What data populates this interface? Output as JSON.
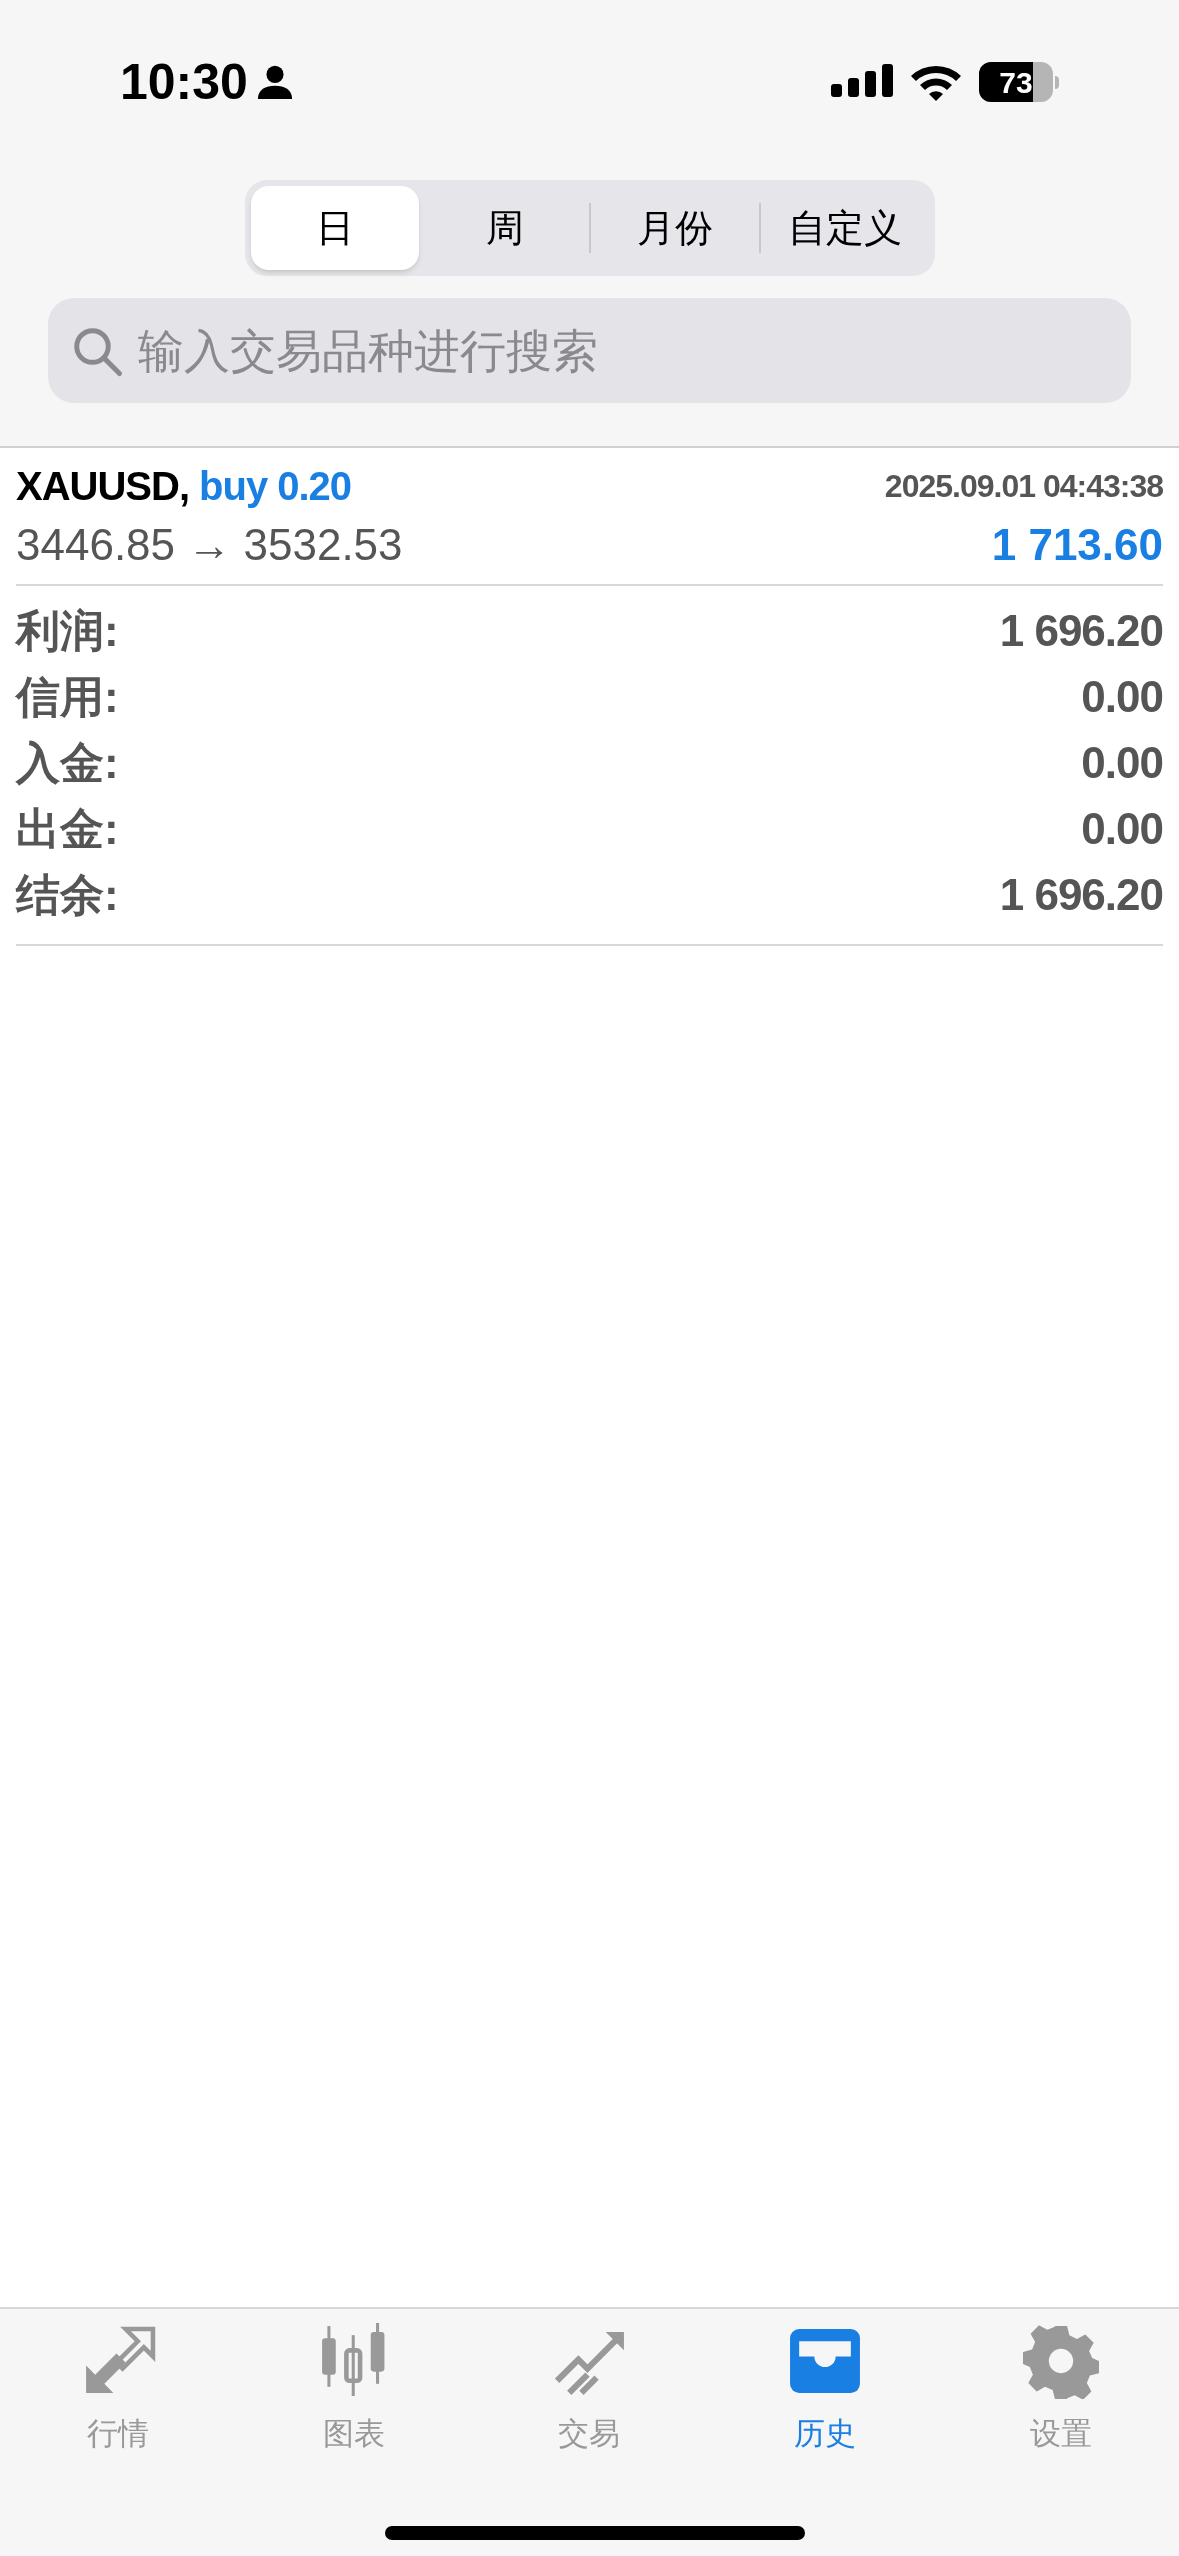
{
  "status_bar": {
    "time": "10:30",
    "battery": "73"
  },
  "period_tabs": [
    {
      "label": "日",
      "selected": true
    },
    {
      "label": "周",
      "selected": false
    },
    {
      "label": "月份",
      "selected": false
    },
    {
      "label": "自定义",
      "selected": false
    }
  ],
  "search": {
    "placeholder": "输入交易品种进行搜索"
  },
  "trade": {
    "symbol": "XAUUSD,",
    "side": "buy 0.20",
    "time": "2025.09.01 04:43:38",
    "prices": "3446.85 → 3532.53",
    "profit": "1 713.60"
  },
  "summary": [
    {
      "label": "利润:",
      "value": "1 696.20"
    },
    {
      "label": "信用:",
      "value": "0.00"
    },
    {
      "label": "入金:",
      "value": "0.00"
    },
    {
      "label": "出金:",
      "value": "0.00"
    },
    {
      "label": "结余:",
      "value": "1 696.20"
    }
  ],
  "tab_bar": [
    {
      "label": "行情",
      "kind": "quotes",
      "selected": false
    },
    {
      "label": "图表",
      "kind": "chart",
      "selected": false
    },
    {
      "label": "交易",
      "kind": "trade",
      "selected": false
    },
    {
      "label": "历史",
      "kind": "history",
      "selected": true
    },
    {
      "label": "设置",
      "kind": "settings",
      "selected": false
    }
  ]
}
